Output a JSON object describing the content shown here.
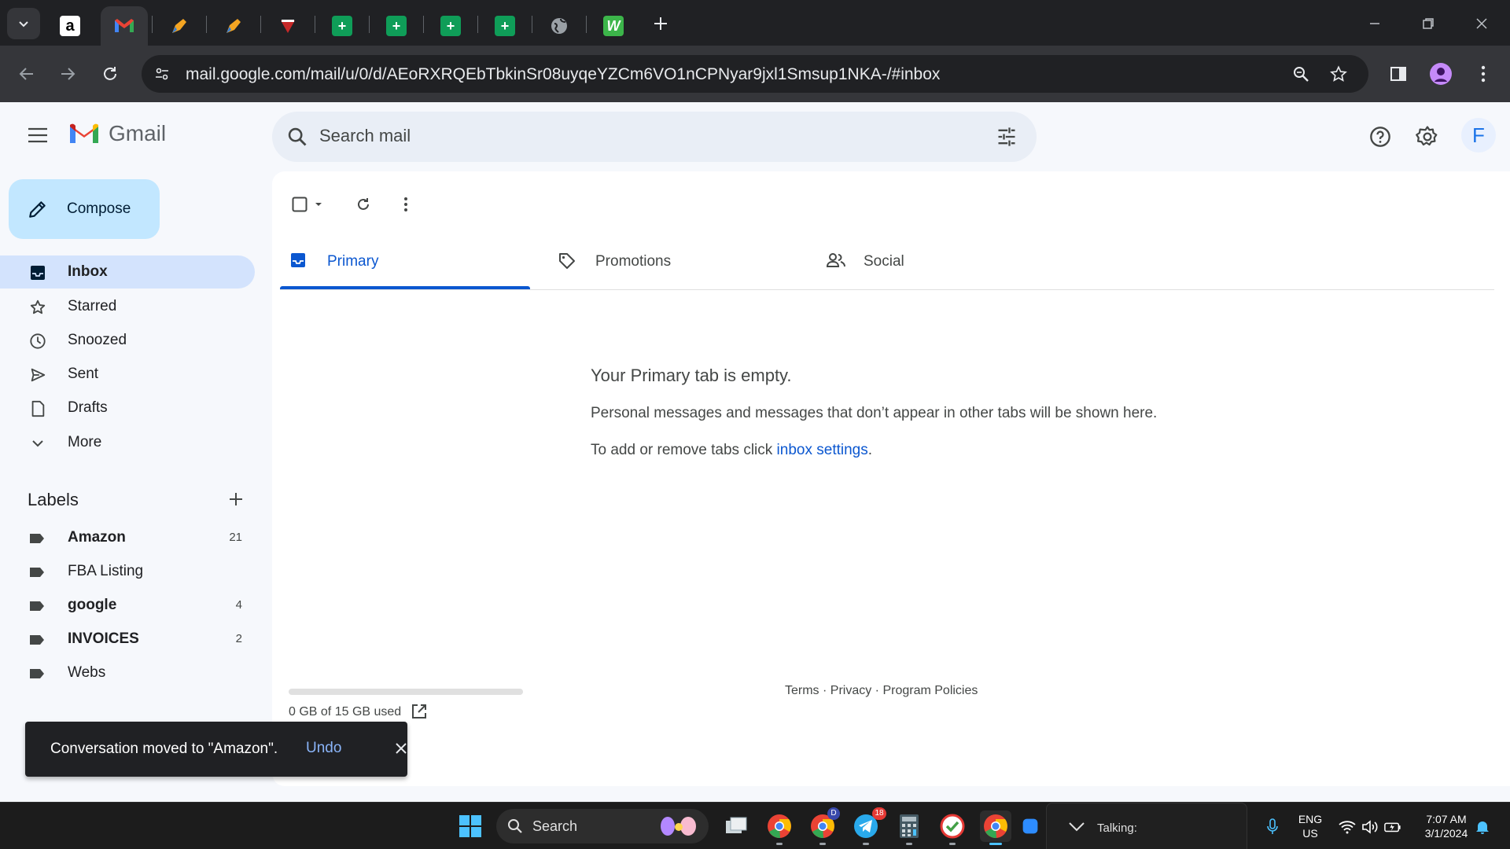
{
  "browser": {
    "url": "mail.google.com/mail/u/0/d/AEoRXRQEbTbkinSr08uyqeYZCm6VO1nCPNyar9jxl1Smsup1NKA-/#inbox",
    "tabs": [
      {
        "icon": "amazon-favicon",
        "letter": "a"
      },
      {
        "icon": "gmail-favicon",
        "letter": "M"
      },
      {
        "icon": "pencil-app-favicon",
        "letter": ""
      },
      {
        "icon": "pencil-app-favicon",
        "letter": ""
      },
      {
        "icon": "red-shield-favicon",
        "letter": ""
      },
      {
        "icon": "sheets-favicon",
        "letter": "+"
      },
      {
        "icon": "sheets-favicon",
        "letter": "+"
      },
      {
        "icon": "sheets-favicon",
        "letter": "+"
      },
      {
        "icon": "sheets-favicon",
        "letter": "+"
      },
      {
        "icon": "globe-favicon",
        "letter": ""
      },
      {
        "icon": "w-app-favicon",
        "letter": "W"
      }
    ]
  },
  "gmail": {
    "brand": "Gmail",
    "search_placeholder": "Search mail",
    "avatar_letter": "F",
    "compose_label": "Compose",
    "nav": [
      {
        "label": "Inbox",
        "icon": "inbox-icon",
        "active": true
      },
      {
        "label": "Starred",
        "icon": "star-icon"
      },
      {
        "label": "Snoozed",
        "icon": "clock-icon"
      },
      {
        "label": "Sent",
        "icon": "send-icon"
      },
      {
        "label": "Drafts",
        "icon": "draft-icon"
      },
      {
        "label": "More",
        "icon": "chevron-down-icon"
      }
    ],
    "labels_heading": "Labels",
    "labels": [
      {
        "name": "Amazon",
        "count": "21",
        "bold": true
      },
      {
        "name": "FBA Listing",
        "count": "",
        "bold": false
      },
      {
        "name": "google",
        "count": "4",
        "bold": true
      },
      {
        "name": "INVOICES",
        "count": "2",
        "bold": true
      },
      {
        "name": "Webs",
        "count": "",
        "bold": false
      }
    ],
    "tabs": [
      {
        "label": "Primary",
        "active": true
      },
      {
        "label": "Promotions"
      },
      {
        "label": "Social"
      }
    ],
    "empty": {
      "title": "Your Primary tab is empty.",
      "line1": "Personal messages and messages that don’t appear in other tabs will be shown here.",
      "line2_prefix": "To add or remove tabs click ",
      "line2_link": "inbox settings",
      "line2_suffix": "."
    },
    "storage": {
      "text": "0 GB of 15 GB used",
      "used_fraction": 0.0
    },
    "footer": "Terms · Privacy · Program Policies",
    "snackbar": {
      "text": "Conversation moved to \"Amazon\".",
      "action": "Undo"
    }
  },
  "taskbar": {
    "search_label": "Search",
    "talking_label": "Talking:",
    "lang_line1": "ENG",
    "lang_line2": "US",
    "time": "7:07 AM",
    "date": "3/1/2024",
    "telegram_badge": "18",
    "chrome_profile_badge": "D"
  },
  "colors": {
    "accent": "#0b57d0",
    "compose_bg": "#c2e7ff",
    "active_nav_bg": "#d3e3fd",
    "chrome_dark": "#202124"
  }
}
